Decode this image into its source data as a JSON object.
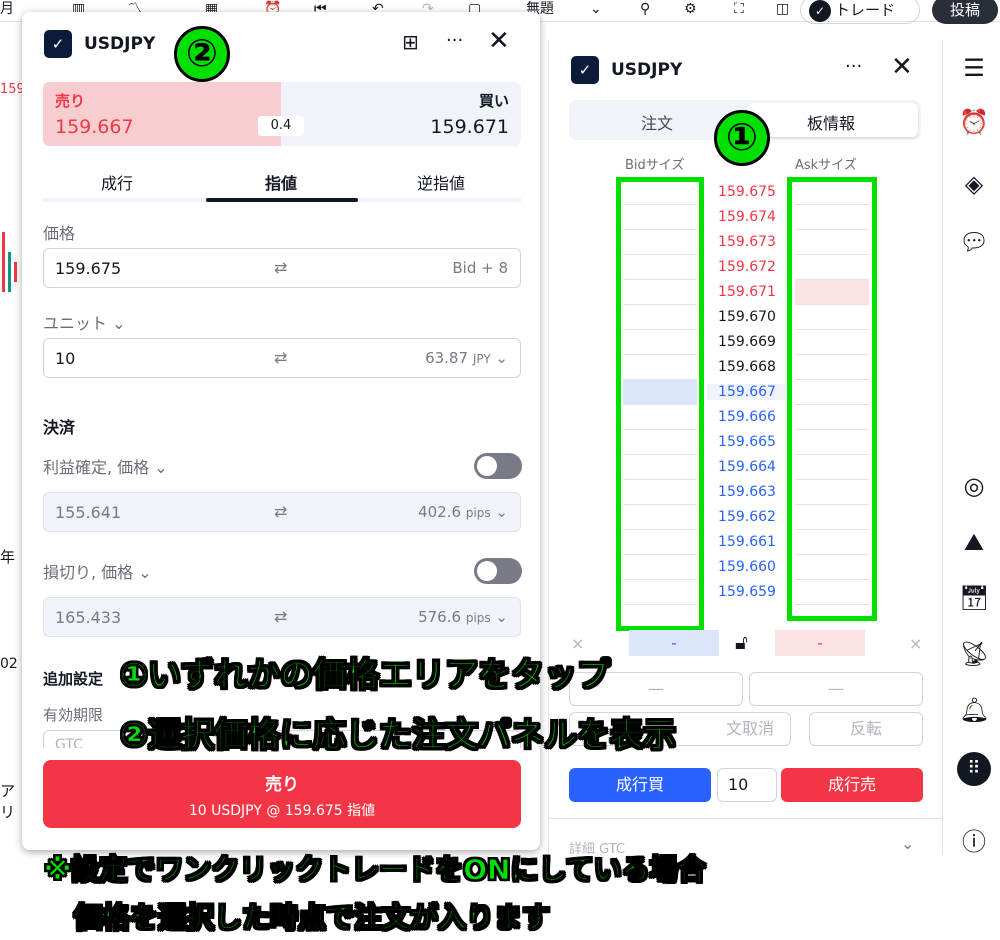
{
  "topbar": {
    "left_text": "月",
    "layout_name": "無題",
    "trade_label": "トレード",
    "post_label": "投稿"
  },
  "left_bg": {
    "price_tag": "159",
    "year": "年",
    "num": "02",
    "ari": "アリ"
  },
  "order_panel": {
    "symbol": "USDJPY",
    "sell_label": "売り",
    "sell_price": "159.667",
    "buy_label": "買い",
    "buy_price": "159.671",
    "spread": "0.4",
    "tabs": [
      "成行",
      "指値",
      "逆指値"
    ],
    "price_label": "価格",
    "price_value": "159.675",
    "price_suffix": "Bid + 8",
    "units_label": "ユニット",
    "units_value": "10",
    "units_value_jpy": "63.87",
    "units_currency": "JPY",
    "settlement_label": "決済",
    "tp_label": "利益確定, 価格",
    "tp_value": "155.641",
    "tp_pips": "402.6",
    "pips_unit": "pips",
    "sl_label": "損切り, 価格",
    "sl_value": "165.433",
    "sl_pips": "576.6",
    "extra_label": "追加設定",
    "validity_label": "有効期限",
    "validity_value": "GTC",
    "submit_title": "売り",
    "submit_sub": "10 USDJPY @ 159.675 指値"
  },
  "dom_panel": {
    "symbol": "USDJPY",
    "tabs": [
      "注文",
      "板情報"
    ],
    "bid_header": "Bidサイズ",
    "ask_header": "Askサイズ",
    "prices": [
      "159.675",
      "159.674",
      "159.673",
      "159.672",
      "159.671",
      "159.670",
      "159.669",
      "159.668",
      "159.667",
      "159.666",
      "159.665",
      "159.664",
      "159.663",
      "159.662",
      "159.661",
      "159.660",
      "159.659"
    ],
    "dash": "-",
    "cancel_label": "文取消",
    "reverse_label": "反転",
    "market_buy": "成行買",
    "qty": "10",
    "market_sell": "成行売",
    "details": "詳細 GTC",
    "colors": {
      "ask_red": "#f23645",
      "bid_blue": "#2962ff",
      "neutral": "#131722"
    }
  },
  "annotations": {
    "n1": "①",
    "n2": "②",
    "line1": "①いずれかの価格エリアをタップ",
    "line2": "②選択価格に応じた注文パネルを表示",
    "line3": "※設定でワンクリックトレードをONにしている場合",
    "line4": "価格を選択した時点で注文が入ります"
  }
}
